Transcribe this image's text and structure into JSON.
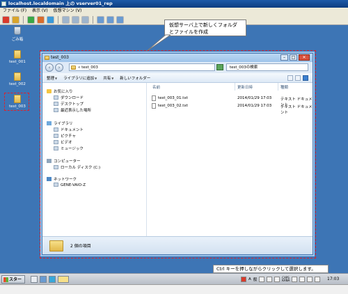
{
  "vm": {
    "title": "localhost.localdomain 上の vserver01_rep",
    "menu": [
      "ファイル (F)",
      "表示 (V)",
      "仮想マシン (V)"
    ]
  },
  "desktop": {
    "icons": [
      {
        "label": "ごみ箱",
        "icon": "recycle-bin-icon"
      },
      {
        "label": "test_001",
        "icon": "folder-icon"
      },
      {
        "label": "test_002",
        "icon": "folder-icon"
      },
      {
        "label": "test_003",
        "icon": "folder-icon"
      }
    ]
  },
  "callout": {
    "line1": "仮想サーバ上で新しくフォルダ",
    "line2": "とファイルを作成"
  },
  "explorer": {
    "title": "test_003",
    "address": "« test_003",
    "search_placeholder": "test_003の検索",
    "commands": [
      "整理",
      "ライブラリに追加",
      "共有",
      "新しいフォルダー"
    ],
    "nav": {
      "favorites": "お気に入り",
      "favorites_items": [
        "ダウンロード",
        "デスクトップ",
        "最近表示した場所"
      ],
      "libraries": "ライブラリ",
      "libraries_items": [
        "ドキュメント",
        "ピクチャ",
        "ビデオ",
        "ミュージック"
      ],
      "computer": "コンピューター",
      "computer_items": [
        "ローカル ディスク (C:)"
      ],
      "network": "ネットワーク",
      "network_items": [
        "GENE-VAIO-Z"
      ]
    },
    "columns": {
      "name": "名前",
      "modified": "更新日時",
      "type": "種類"
    },
    "files": [
      {
        "name": "test_003_01.txt",
        "date": "2014/01/29 17:03",
        "type": "テキスト ドキュメント"
      },
      {
        "name": "test_003_02.txt",
        "date": "2014/01/29 17:03",
        "type": "テキスト ドキュメント"
      }
    ],
    "details": "2 個の項目"
  },
  "hint": "Ctrl キーを押しながらクリックして選択します。",
  "taskbar": {
    "start": "スタート",
    "tray": [
      "A",
      "般"
    ],
    "caps": "CAPS",
    "kana": "KANA",
    "clock": "17:03"
  },
  "colors": {
    "desktop": "#3d75b5",
    "highlight": "#e0202a"
  }
}
